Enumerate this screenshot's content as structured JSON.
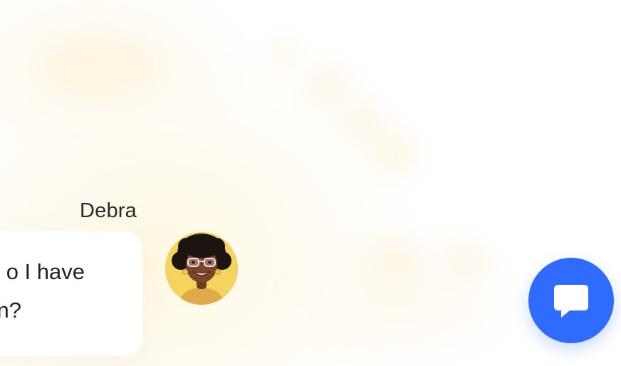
{
  "conversation": {
    "sender_name": "Debra",
    "message_lines": [
      "o I have",
      "n?"
    ],
    "avatar_icon": "person-portrait-icon"
  },
  "widget": {
    "chat_button_icon": "chat-bubble-icon",
    "accent_color": "#2F6BFF"
  }
}
